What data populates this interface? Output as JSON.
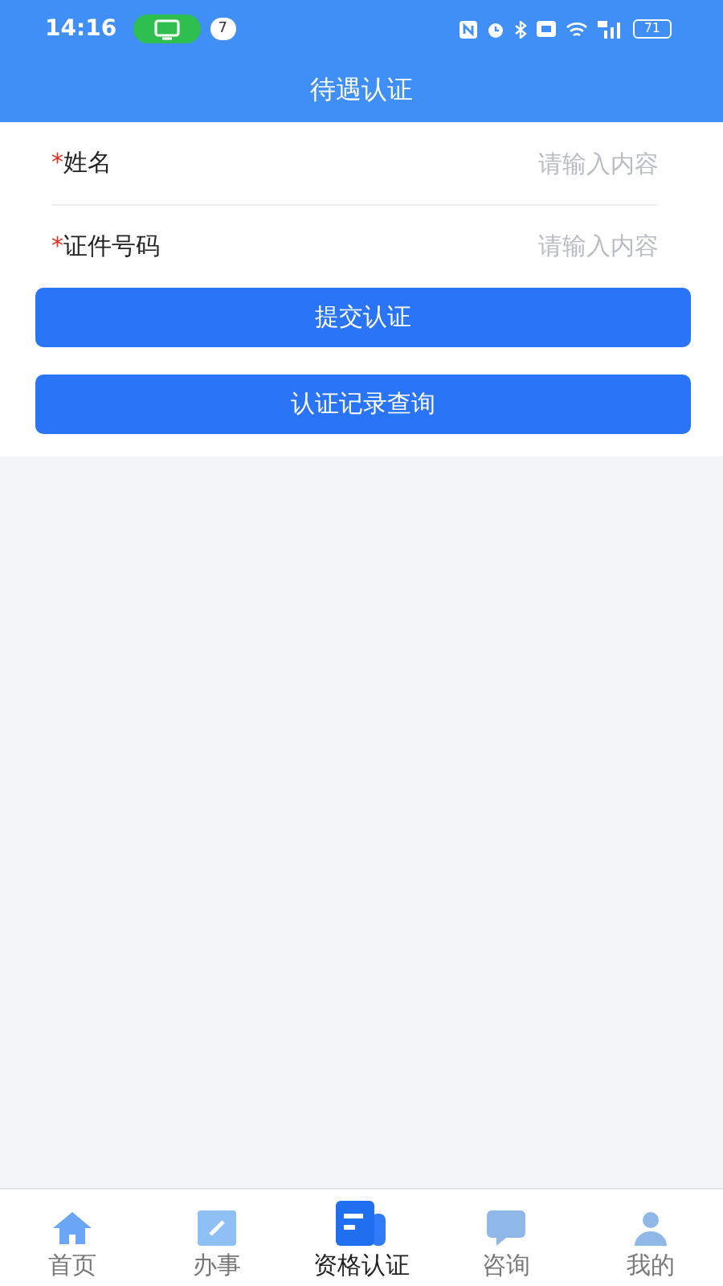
{
  "status_bar": {
    "time": "14:16",
    "notification_count": "7",
    "battery": "71"
  },
  "title": "待遇认证",
  "fields": [
    {
      "required_mark": "*",
      "label": "姓名",
      "placeholder": "请输入内容"
    },
    {
      "required_mark": "*",
      "label": "证件号码",
      "placeholder": "请输入内容"
    }
  ],
  "buttons": [
    "提交认证",
    "认证记录查询"
  ],
  "tabs": [
    {
      "label": "首页",
      "selected": false
    },
    {
      "label": "办事",
      "selected": false
    },
    {
      "label": "资格认证",
      "selected": true
    },
    {
      "label": "咨询",
      "selected": false
    },
    {
      "label": "我的",
      "selected": false
    }
  ]
}
